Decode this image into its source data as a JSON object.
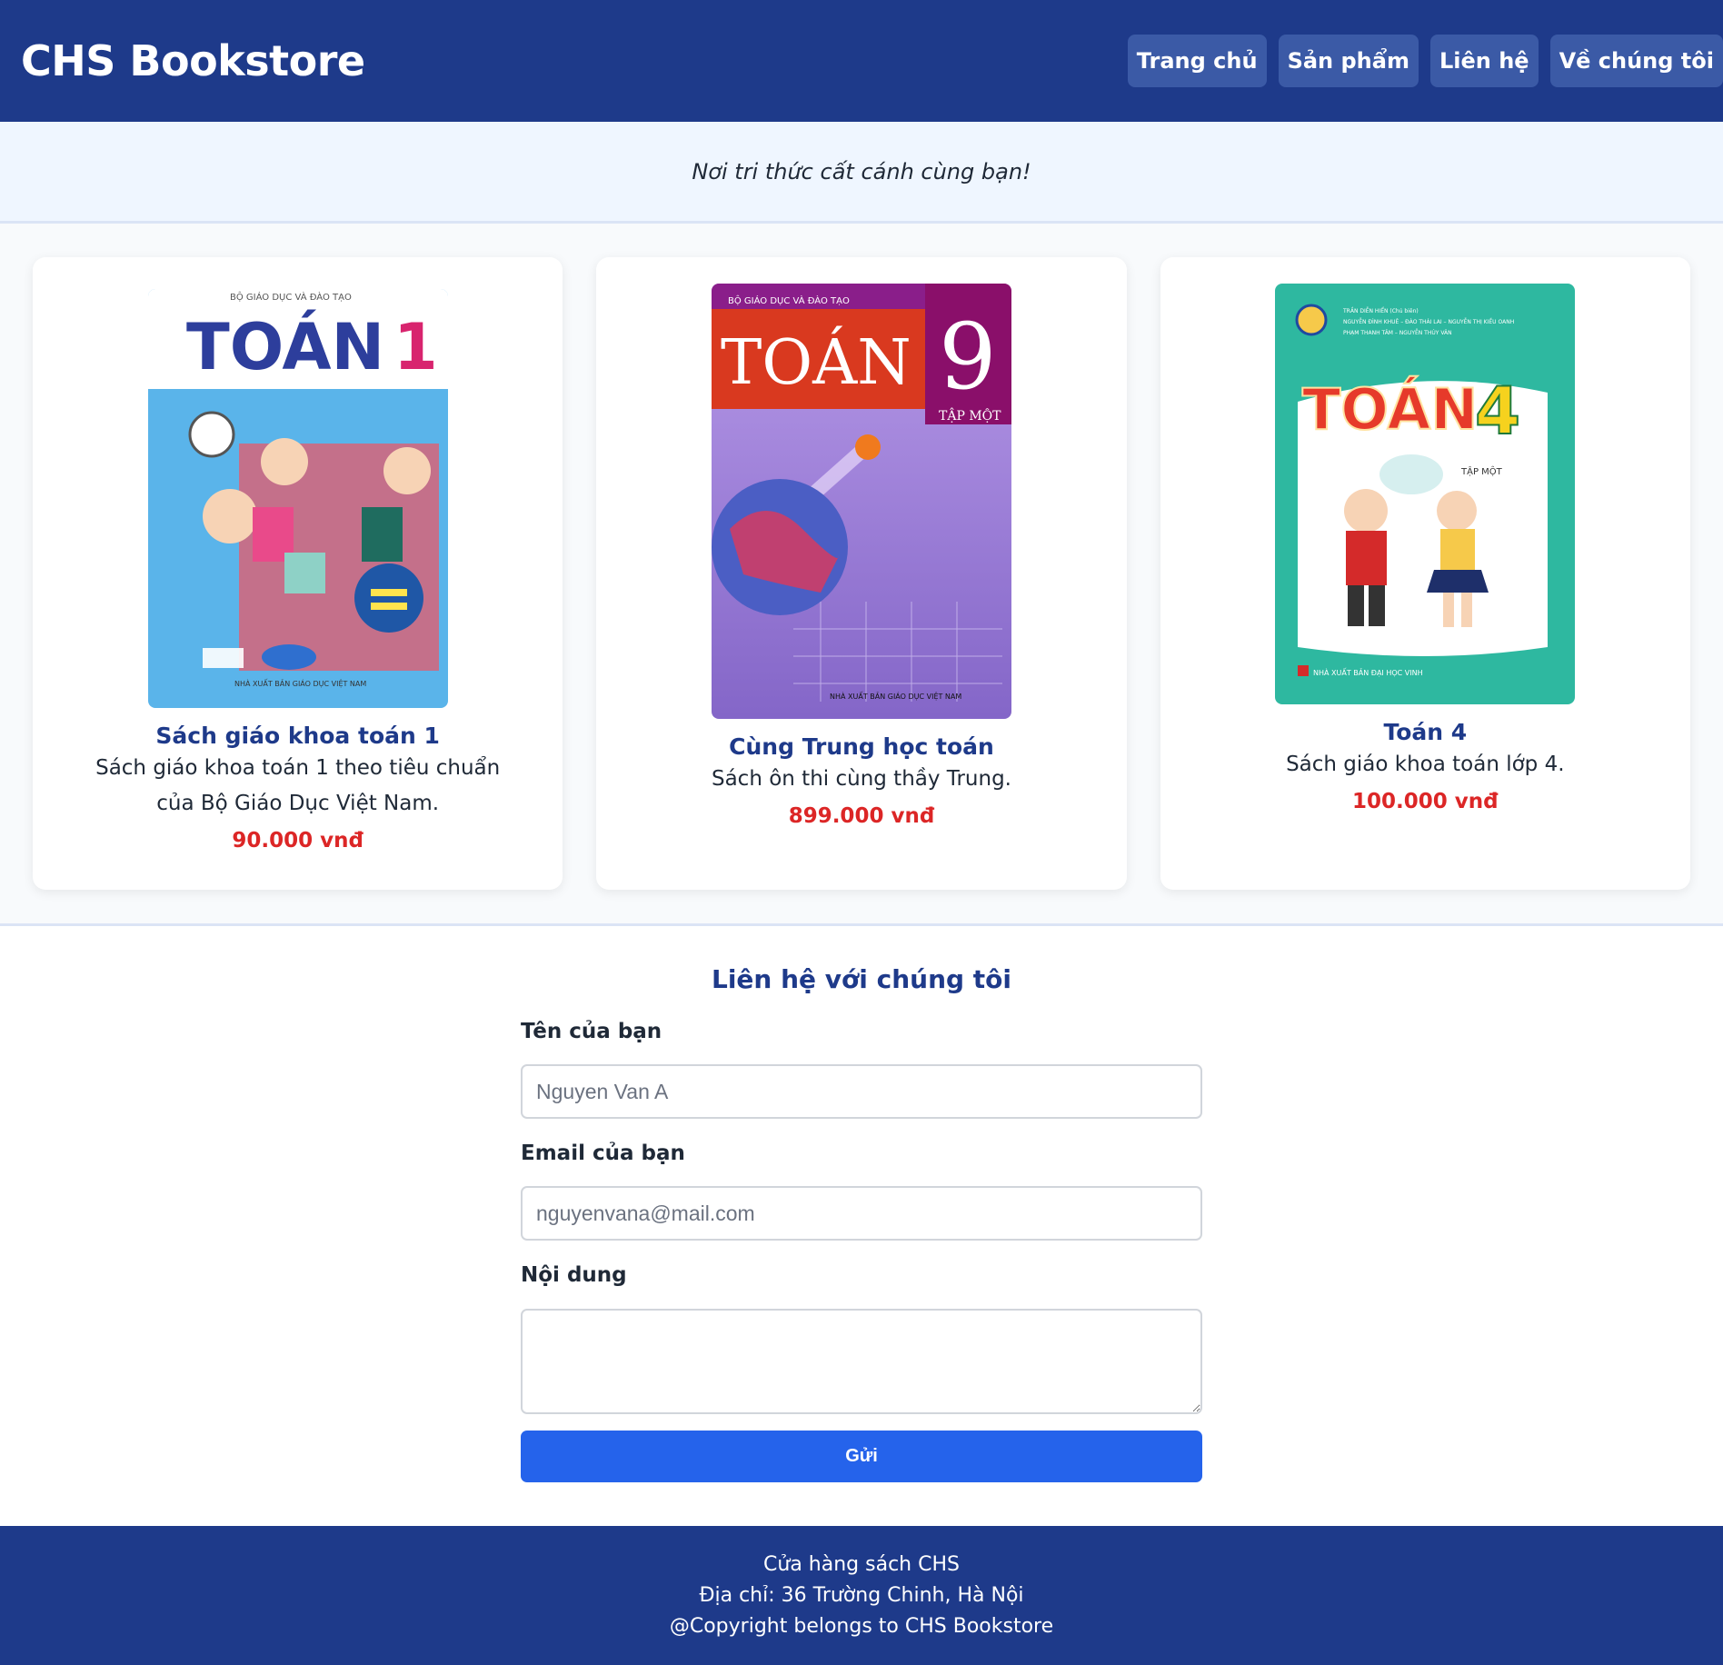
{
  "header": {
    "brand": "CHS Bookstore",
    "nav": [
      "Trang chủ",
      "Sản phẩm",
      "Liên hệ",
      "Về chúng tôi"
    ]
  },
  "tagline": "Nơi tri thức cất cánh cùng bạn!",
  "products": [
    {
      "title": "Sách giáo khoa toán 1",
      "description": "Sách giáo khoa toán 1 theo tiêu chuẩn của Bộ Giáo Dục Việt Nam.",
      "price": "90.000 vnđ",
      "cover": {
        "publisher_top": "BỘ GIÁO DỤC VÀ ĐÀO TẠO",
        "word": "TOÁN",
        "number": "1",
        "bottom": "NHÀ XUẤT BẢN GIÁO DỤC VIỆT NAM"
      }
    },
    {
      "title": "Cùng Trung học toán",
      "description": "Sách ôn thi cùng thầy Trung.",
      "price": "899.000 vnđ",
      "cover": {
        "publisher_top": "BỘ GIÁO DỤC VÀ ĐÀO TẠO",
        "word": "TOÁN",
        "number": "9",
        "volume": "TẬP MỘT",
        "bottom": "NHÀ XUẤT BẢN GIÁO DỤC VIỆT NAM"
      }
    },
    {
      "title": "Toán 4",
      "description": "Sách giáo khoa toán lớp 4.",
      "price": "100.000 vnđ",
      "cover": {
        "authors_1": "TRẦN DIỄN HIỂN (Chủ biên)",
        "authors_2": "NGUYỄN ĐÌNH KHUÊ – ĐÀO THÁI LAI – NGUYỄN THỊ KIỀU OANH",
        "authors_3": "PHẠM THANH TÂM – NGUYỄN THÚY VÂN",
        "word": "TOÁN",
        "number": "4",
        "volume": "TẬP MỘT",
        "bottom": "NHÀ XUẤT BẢN ĐẠI HỌC VINH"
      }
    }
  ],
  "contact": {
    "title": "Liên hệ với chúng tôi",
    "name_label": "Tên của bạn",
    "name_placeholder": "Nguyen Van A",
    "email_label": "Email của bạn",
    "email_placeholder": "nguyenvana@mail.com",
    "message_label": "Nội dung",
    "submit_label": "Gửi"
  },
  "footer": {
    "line1": "Cửa hàng sách CHS",
    "line2": "Địa chỉ: 36 Trường Chinh, Hà Nội",
    "line3": "@Copyright belongs to CHS Bookstore"
  },
  "colors": {
    "primary": "#1e3a8a",
    "accent": "#2563eb",
    "price": "#dc2626"
  }
}
